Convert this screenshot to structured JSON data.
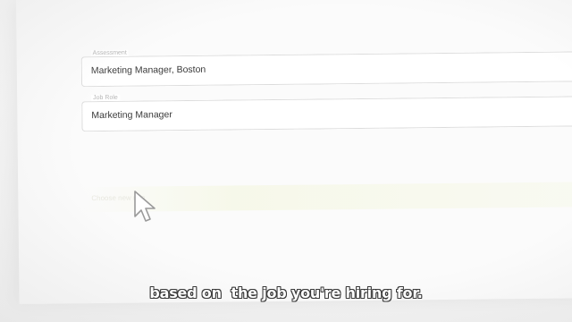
{
  "form": {
    "assessment": {
      "label": "Assessment",
      "value": "Marketing Manager, Boston"
    },
    "job_role": {
      "label": "Job Role",
      "value": "Marketing Manager"
    },
    "faded_row_text": "Choose new role"
  },
  "cursor": {
    "icon": "arrow-pointer-icon"
  },
  "caption": {
    "text": "based on  the job you're hiring for."
  }
}
